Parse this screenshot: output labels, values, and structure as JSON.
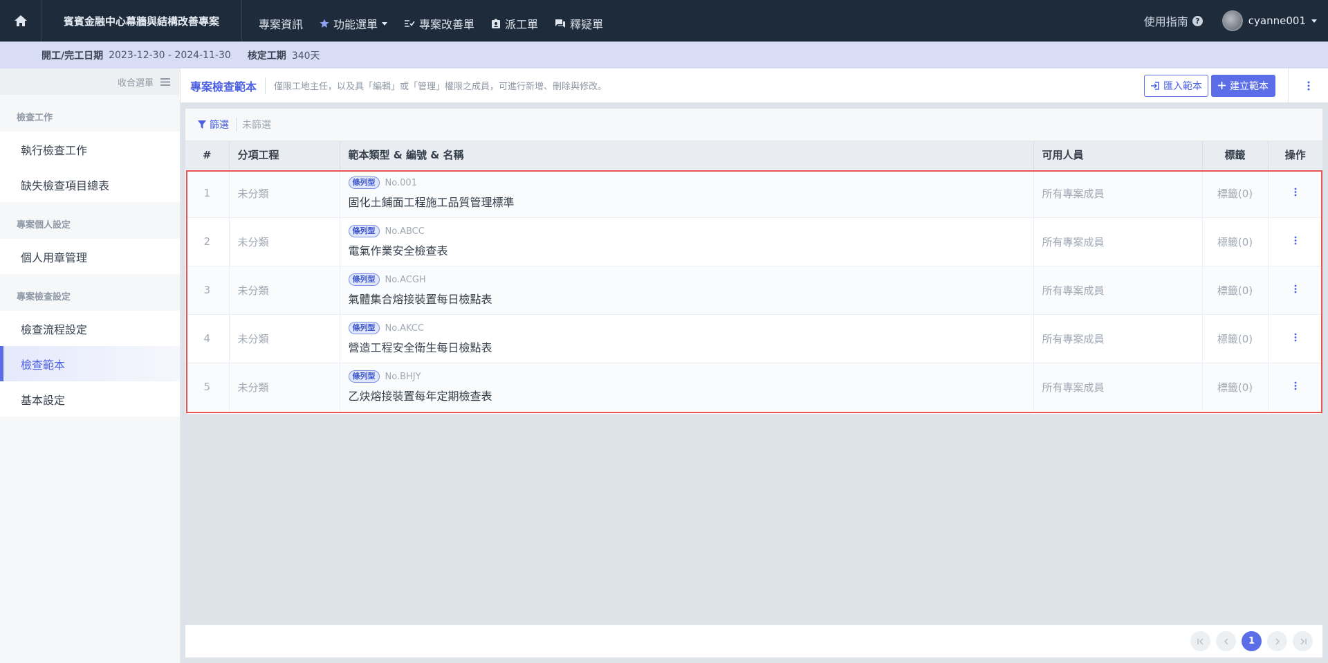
{
  "topbar": {
    "project_name": "賓賓金融中心幕牆與結構改善專案",
    "nav": [
      {
        "label": "專案資訊",
        "icon": "none"
      },
      {
        "label": "功能選單",
        "icon": "star-icon",
        "dropdown": true
      },
      {
        "label": "專案改善單",
        "icon": "checklist-icon"
      },
      {
        "label": "派工單",
        "icon": "badge-icon"
      },
      {
        "label": "釋疑單",
        "icon": "chat-icon"
      }
    ],
    "guide_label": "使用指南",
    "username": "cyanne001"
  },
  "infobar": {
    "period_label": "開工/完工日期",
    "period_value": "2023-12-30 - 2024-11-30",
    "duration_label": "核定工期",
    "duration_value": "340天"
  },
  "sidebar": {
    "collapse_label": "收合選單",
    "groups": [
      {
        "title": "檢查工作",
        "items": [
          "執行檢查工作",
          "缺失檢查項目總表"
        ]
      },
      {
        "title": "專案個人設定",
        "items": [
          "個人用章管理"
        ]
      },
      {
        "title": "專案檢查設定",
        "items": [
          "檢查流程設定",
          "檢查範本",
          "基本設定"
        ]
      }
    ],
    "active_item": "檢查範本"
  },
  "main": {
    "title": "專案檢查範本",
    "description": "僅限工地主任，以及具「編輯」或「管理」權限之成員，可進行新增、刪除與修改。",
    "import_label": "匯入範本",
    "create_label": "建立範本"
  },
  "filter": {
    "label": "篩選",
    "state": "未篩選"
  },
  "table": {
    "headers": [
      "#",
      "分項工程",
      "範本類型 & 編號 & 名稱",
      "可用人員",
      "標籤",
      "操作"
    ],
    "rows": [
      {
        "num": "1",
        "category": "未分類",
        "type": "條列型",
        "code": "No.001",
        "name": "固化土鋪面工程施工品質管理標準",
        "users": "所有專案成員",
        "tags": "標籤(0)"
      },
      {
        "num": "2",
        "category": "未分類",
        "type": "條列型",
        "code": "No.ABCC",
        "name": "電氣作業安全檢查表",
        "users": "所有專案成員",
        "tags": "標籤(0)"
      },
      {
        "num": "3",
        "category": "未分類",
        "type": "條列型",
        "code": "No.ACGH",
        "name": "氣體集合熔接裝置每日檢點表",
        "users": "所有專案成員",
        "tags": "標籤(0)"
      },
      {
        "num": "4",
        "category": "未分類",
        "type": "條列型",
        "code": "No.AKCC",
        "name": "營造工程安全衛生每日檢點表",
        "users": "所有專案成員",
        "tags": "標籤(0)"
      },
      {
        "num": "5",
        "category": "未分類",
        "type": "條列型",
        "code": "No.BHJY",
        "name": "乙炔熔接裝置每年定期檢查表",
        "users": "所有專案成員",
        "tags": "標籤(0)"
      }
    ]
  },
  "pagination": {
    "current_page": "1"
  },
  "colors": {
    "accent": "#5b6ee8",
    "topbar": "#1e2b3a",
    "highlight": "#e55353"
  }
}
